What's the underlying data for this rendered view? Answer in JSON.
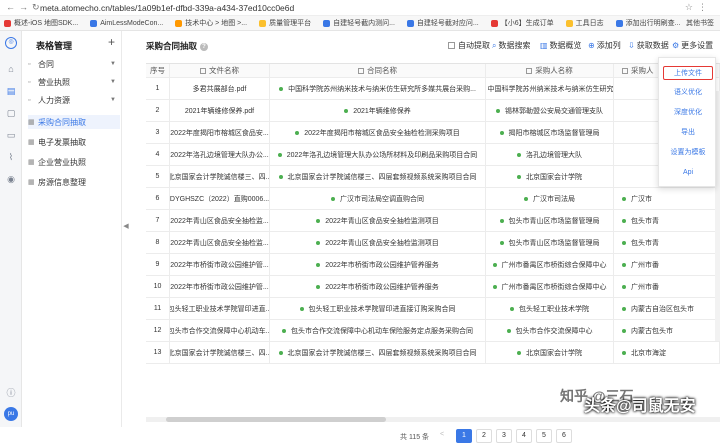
{
  "browser": {
    "url": "meta.atomecho.cn/tables/1a09b1ef-dfbd-339a-a434-37ed10cc0e6d",
    "bookmarks": [
      "概述-iOS 地图SDK...",
      "AimLessModeCon...",
      "技术中心 > 地图 >...",
      "质量管理平台",
      "自建轻号截内测问...",
      "自建轻号截对应问...",
      "【小6】生成订单",
      "工具日志",
      "添加出行明刷查..."
    ],
    "bookmarks_right": "其他书签"
  },
  "rail": {
    "avatar": "pu"
  },
  "sidebar": {
    "title": "表格管理",
    "add": "+",
    "items": [
      {
        "label": "合同"
      },
      {
        "label": "营业执照"
      },
      {
        "label": "人力资源"
      },
      {
        "label": "采购合同抽取"
      },
      {
        "label": "电子发票抽取"
      },
      {
        "label": "企业营业执照"
      },
      {
        "label": "房源信息整理"
      }
    ]
  },
  "toolbar": {
    "title": "采购合同抽取",
    "auto_extract": "自动提取",
    "data_search": "数据搜索",
    "data_overview": "数据概览",
    "add_column": "添加列",
    "get_data": "获取数据",
    "more_settings": "更多设置"
  },
  "table": {
    "headers": [
      "序号",
      "文件名称",
      "合同名称",
      "采购人名称",
      "采购人"
    ],
    "rows": [
      {
        "no": "1",
        "file": "多君共展部台.pdf",
        "contract": "中国科学院苏州纳米技术与纳米仿生研究所多媒共展台采购...",
        "buyer": "中国科学院苏州纳米技术与纳米仿生研究所",
        "buyer2": ""
      },
      {
        "no": "2",
        "file": "2021年辆维修保养.pdf",
        "contract": "2021年辆维修保养",
        "buyer": "锡林郭勒盟公安局交通管理支队",
        "buyer2": ""
      },
      {
        "no": "3",
        "file": "2022年度揭阳市榕城区食品安...",
        "contract": "2022年度揭阳市榕城区食品安全抽检检测采购项目",
        "buyer": "揭阳市榕城区市场监督管理局",
        "buyer2": ""
      },
      {
        "no": "4",
        "file": "2022年洛孔边境管理大队办公...",
        "contract": "2022年洛孔边境管理大队办公场所材料及印刷品采购项目合同",
        "buyer": "洛孔边境管理大队",
        "buyer2": ""
      },
      {
        "no": "5",
        "file": "北京国家会计学院诚信楼三、四...",
        "contract": "北京国家会计学院诚信楼三、四层套频视频系统采购项目合同",
        "buyer": "北京国家会计学院",
        "buyer2": ""
      },
      {
        "no": "6",
        "file": "DYGHSZC（2022）直购0006...",
        "contract": "广汉市司法局空调直购合同",
        "buyer": "广汉市司法局",
        "buyer2": "广汉市"
      },
      {
        "no": "7",
        "file": "2022年青山区食品安全抽检监...",
        "contract": "2022年青山区食品安全抽检监测项目",
        "buyer": "包头市青山区市场监督管理局",
        "buyer2": "包头市青"
      },
      {
        "no": "8",
        "file": "2022年青山区食品安全抽检监...",
        "contract": "2022年青山区食品安全抽检监测项目",
        "buyer": "包头市青山区市场监督管理局",
        "buyer2": "包头市青"
      },
      {
        "no": "9",
        "file": "2022年市桥街市政公园维护管...",
        "contract": "2022年市桥街市政公园维护管养服务",
        "buyer": "广州市番禺区市桥街综合保障中心",
        "buyer2": "广州市番"
      },
      {
        "no": "10",
        "file": "2022年市桥街市政公园维护管...",
        "contract": "2022年市桥街市政公园维护管养服务",
        "buyer": "广州市番禺区市桥街综合保障中心",
        "buyer2": "广州市番"
      },
      {
        "no": "11",
        "file": "包头轻工职业技术学院冒印进直...",
        "contract": "包头轻工职业技术学院冒印进直接订购采购合同",
        "buyer": "包头轻工职业技术学院",
        "buyer2": "内蒙古自治区包头市"
      },
      {
        "no": "12",
        "file": "包头市合作交流保障中心机动车...",
        "contract": "包头市合作交流保障中心机动车保险服务定点服务采购合同",
        "buyer": "包头市合作交流保障中心",
        "buyer2": "内蒙古包头市"
      },
      {
        "no": "13",
        "file": "北京国家会计学院诚信楼三、四...",
        "contract": "北京国家会计学院诚信楼三、四层套频视频系统采购项目合同",
        "buyer": "北京国家会计学院",
        "buyer2": "北京市海淀"
      }
    ]
  },
  "pagination": {
    "total": "共 115 条",
    "prev": "<",
    "pages": [
      "1",
      "2",
      "3",
      "4",
      "5",
      "6"
    ]
  },
  "dropdown": {
    "items": [
      "上传文件",
      "语义优化",
      "深度优化",
      "导出",
      "设置为模板",
      "Api"
    ]
  },
  "watermark": {
    "text1": "知乎 @三石",
    "text2": "头条@司鼠无安"
  }
}
